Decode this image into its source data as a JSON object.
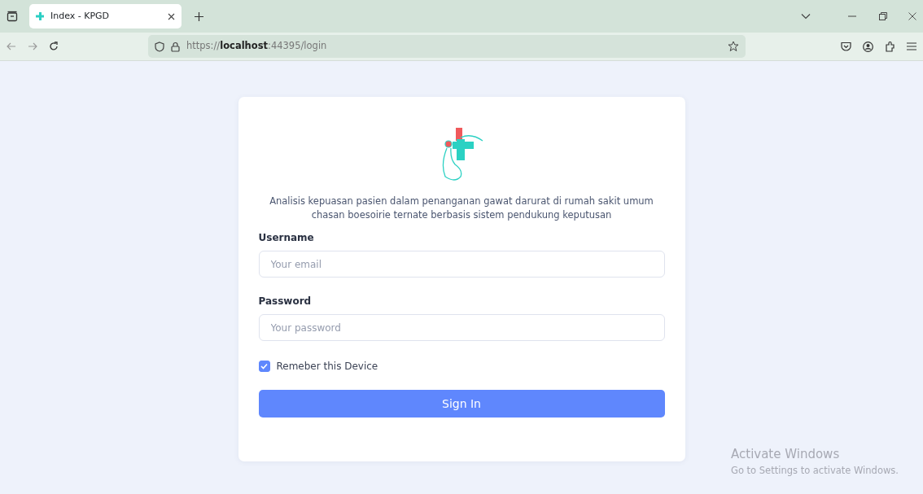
{
  "browser": {
    "tab": {
      "title": "Index - KPGD",
      "selected": true
    },
    "address": "https://**localhost**:44395/login"
  },
  "login": {
    "description": "Analisis kepuasan pasien dalam penanganan gawat darurat di rumah sakit umum chasan boesoirie ternate berbasis sistem pendukung keputusan",
    "fields": [
      {
        "label": "Username",
        "placeholder": "Your email"
      },
      {
        "label": "Password",
        "placeholder": "Your password"
      }
    ],
    "remember": {
      "label": "Remeber this Device",
      "checked": true
    },
    "submit": "Sign In"
  },
  "os_notice": {
    "title": "Activate Windows",
    "subtitle": "Go to Settings to activate Windows."
  }
}
